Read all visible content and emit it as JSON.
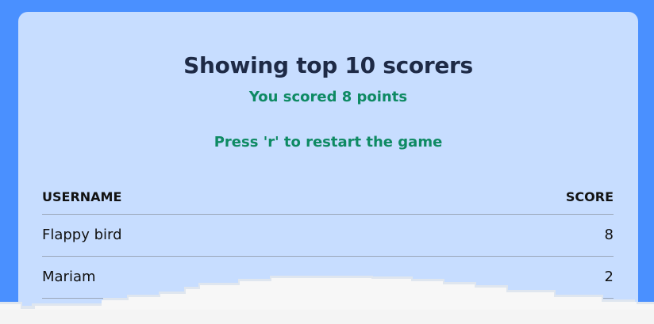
{
  "leaderboard": {
    "title": "Showing top 10 scorers",
    "player_score_text": "You scored 8 points",
    "restart_hint": "Press 'r' to restart the game",
    "columns": {
      "username": "USERNAME",
      "score": "SCORE"
    },
    "rows": [
      {
        "username": "Flappy bird",
        "score": "8"
      },
      {
        "username": "Mariam",
        "score": "2"
      }
    ]
  },
  "colors": {
    "sky": "#4a90ff",
    "panel": "#c7ddff",
    "title": "#1e2a46",
    "accent_green": "#0e8a63",
    "cloud": "#f7f7f7"
  }
}
